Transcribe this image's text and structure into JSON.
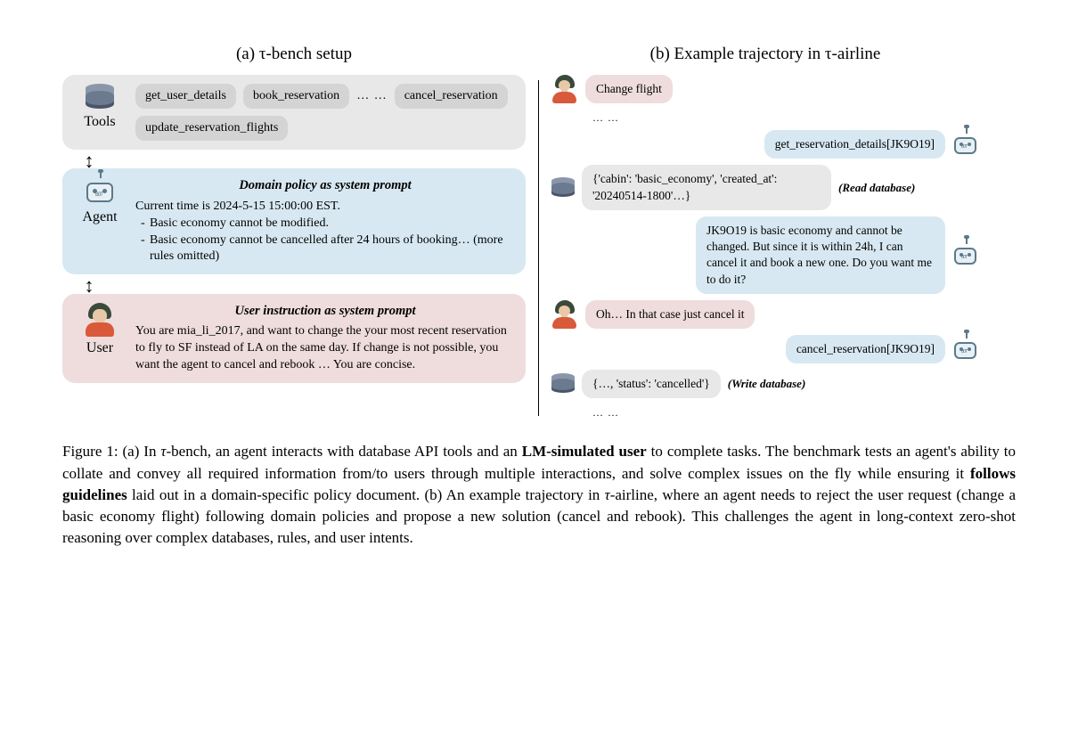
{
  "panelA": {
    "title": "(a) τ-bench setup",
    "tools": {
      "label": "Tools",
      "items": [
        "get_user_details",
        "book_reservation",
        "cancel_reservation",
        "update_reservation_flights"
      ],
      "ellipsis": "…  …"
    },
    "agent": {
      "label": "Agent",
      "heading": "Domain policy as system prompt",
      "time_line": "Current time is 2024-5-15 15:00:00 EST.",
      "rule1": "Basic economy cannot be modified.",
      "rule2": "Basic economy cannot be cancelled after 24 hours of booking… (more rules omitted)"
    },
    "user": {
      "label": "User",
      "heading": "User instruction as system prompt",
      "text": "You are mia_li_2017, and want to change the your most recent reservation to fly to SF instead of LA on the same day. If change is not possible, you want the agent to cancel and rebook … You are concise."
    }
  },
  "panelB": {
    "title": "(b) Example trajectory in τ-airline",
    "msg1": "Change flight",
    "ellipsis1": "…  …",
    "msg2": "get_reservation_details[JK9O19]",
    "msg3": "{'cabin': 'basic_economy', 'created_at': '20240514-1800'…}",
    "note_read": "(Read database)",
    "msg4": "JK9O19 is basic economy and cannot be changed. But since it is within 24h, I can cancel it and book a new one. Do you want me to do it?",
    "msg5": "Oh… In that case just cancel it",
    "msg6": "cancel_reservation[JK9O19]",
    "msg7": "{…, 'status': 'cancelled'}",
    "note_write": "(Write database)",
    "ellipsis2": "…  …"
  },
  "caption": {
    "prefix": "Figure 1: (a) In ",
    "tau1": "τ",
    "part1": "-bench, an agent interacts with database API tools and an ",
    "bold1": "LM-simulated user",
    "part2": " to complete tasks. The benchmark tests an agent's ability to collate and convey all required information from/to users through multiple interactions, and solve complex issues on the fly while ensuring it ",
    "bold2": "follows guidelines",
    "part3": " laid out in a domain-specific policy document.  (b) An example trajectory in ",
    "tau2": "τ",
    "part4": "-airline, where an agent needs to reject the user request (change a basic economy flight) following domain policies and propose a new solution (cancel and rebook).  This challenges the agent in long-context zero-shot reasoning over complex databases, rules, and user intents."
  }
}
